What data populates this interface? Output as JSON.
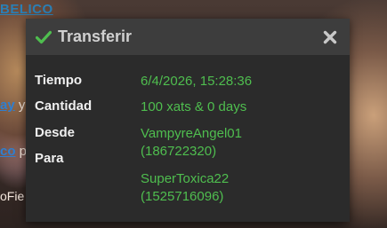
{
  "background": {
    "title": "BELICO",
    "line1_link": "ay",
    "line1_rest": " y",
    "line2_link": "co",
    "line2_rest": " p",
    "line3": "oFie"
  },
  "dialog": {
    "title": "Transferir",
    "icon": "check-icon",
    "close_icon": "close-icon",
    "accent_color": "#4fbe4f",
    "rows": {
      "tiempo_label": "Tiempo",
      "tiempo_value": "6/4/2026, 15:28:36",
      "cantidad_label": "Cantidad",
      "cantidad_value": "100 xats & 0 days",
      "desde_label": "Desde",
      "desde_name": "VampyreAngel01",
      "desde_id": "(186722320)",
      "para_label": "Para",
      "para_name": "SuperToxica22",
      "para_id": "(1525716096)"
    }
  }
}
